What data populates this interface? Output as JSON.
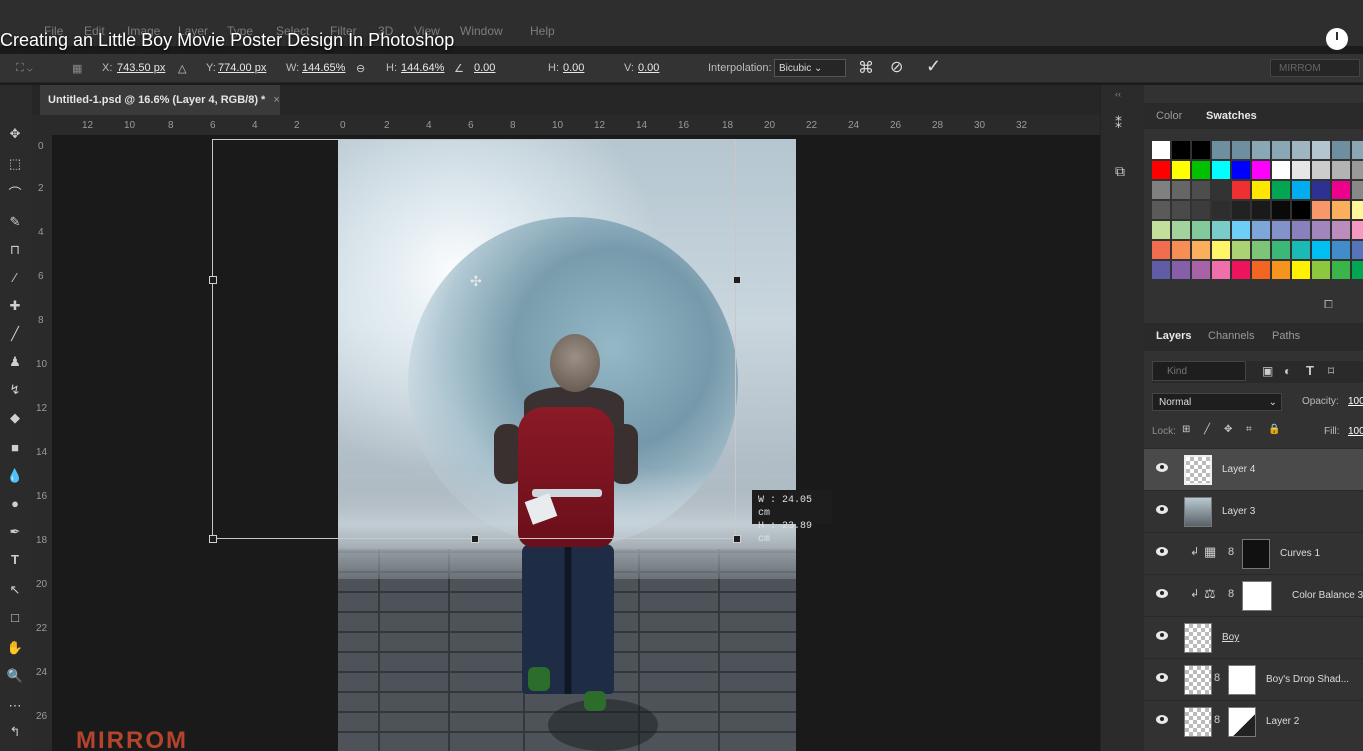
{
  "video_title": "Creating an Little Boy Movie Poster Design In Photoshop",
  "menu": [
    "File",
    "Edit",
    "Image",
    "Layer",
    "Type",
    "Select",
    "Filter",
    "3D",
    "View",
    "Window",
    "Help"
  ],
  "options": {
    "x_label": "X:",
    "x_value": "743.50 px",
    "y_label": "Y:",
    "y_value": "774.00 px",
    "w_label": "W:",
    "w_value": "144.65%",
    "h_label": "H:",
    "h_value": "144.64%",
    "angle_value": "0.00",
    "hskew_label": "H:",
    "hskew_value": "0.00",
    "vskew_label": "V:",
    "vskew_value": "0.00",
    "interp_label": "Interpolation:",
    "interp_value": "Bicubic",
    "workspace": "MIRROM"
  },
  "document": {
    "tab_title": "Untitled-1.psd @ 16.6% (Layer 4, RGB/8) *",
    "close": "×"
  },
  "ruler_h": [
    "12",
    "10",
    "8",
    "6",
    "4",
    "2",
    "0",
    "2",
    "4",
    "6",
    "8",
    "10",
    "12",
    "14",
    "16",
    "18",
    "20",
    "22",
    "24",
    "26",
    "28",
    "30",
    "32"
  ],
  "ruler_v": [
    "0",
    "2",
    "4",
    "6",
    "8",
    "10",
    "12",
    "14",
    "16",
    "18",
    "20",
    "22",
    "24",
    "26"
  ],
  "transform_tip": {
    "w": "W :  24.05 cm",
    "h": "H :  23.89 cm"
  },
  "canvas_watermark": "MIRROM",
  "color_panel": {
    "tabs": [
      "Color",
      "Swatches"
    ],
    "active": "Swatches"
  },
  "swatch_colors": [
    [
      "#ffffff",
      "#000000",
      "#000000",
      "#6d8fa0",
      "#6d8fa0",
      "#8aa7b5",
      "#8aa7b5",
      "#9fb5c1",
      "#b4c5cf",
      "#6d8fa0",
      "#8aa7b5"
    ],
    [
      "#ff0000",
      "#ffff00",
      "#00c000",
      "#00ffff",
      "#0000ff",
      "#ff00ff",
      "#ffffff",
      "#e6e6e6",
      "#cccccc",
      "#b3b3b3",
      "#999999"
    ],
    [
      "#808080",
      "#666666",
      "#4d4d4d",
      "#333333",
      "#f03030",
      "#ffe600",
      "#00a651",
      "#00aeef",
      "#2e3192",
      "#ec008c",
      "#888888"
    ],
    [
      "#5a5a5a",
      "#4a4a4a",
      "#3c3c3c",
      "#2e2e2e",
      "#222222",
      "#1a1a1a",
      "#0a0a0a",
      "#000000",
      "#f7976a",
      "#fbaf5d",
      "#fff799"
    ],
    [
      "#c4df9b",
      "#a3d39c",
      "#82ca9c",
      "#7accc8",
      "#6dcff6",
      "#7da7d9",
      "#8393ca",
      "#8781bd",
      "#a186be",
      "#bd8cbf",
      "#f49ac1"
    ],
    [
      "#f26c4f",
      "#f68e56",
      "#fbaf5d",
      "#fff568",
      "#acd373",
      "#7cc576",
      "#3bb878",
      "#1abbb4",
      "#00bff3",
      "#438ccb",
      "#5574b9"
    ],
    [
      "#605ca8",
      "#855fa8",
      "#a763a8",
      "#f06eaa",
      "#ed145b",
      "#f26522",
      "#f7941d",
      "#fff200",
      "#8dc63f",
      "#39b54a",
      "#00a651"
    ]
  ],
  "layers_panel": {
    "tabs": [
      "Layers",
      "Channels",
      "Paths"
    ],
    "active": "Layers",
    "kind": "Kind",
    "blend_mode": "Normal",
    "opacity_label": "Opacity:",
    "opacity_value": "100",
    "lock_label": "Lock:",
    "fill_label": "Fill:",
    "fill_value": "100",
    "layers": [
      {
        "name": "Layer 4",
        "selected": true
      },
      {
        "name": "Layer 3"
      },
      {
        "name": "Curves 1"
      },
      {
        "name": "Color Balance 3"
      },
      {
        "name": "Boy"
      },
      {
        "name": "Boy's Drop Shad..."
      },
      {
        "name": "Layer 2"
      }
    ]
  }
}
